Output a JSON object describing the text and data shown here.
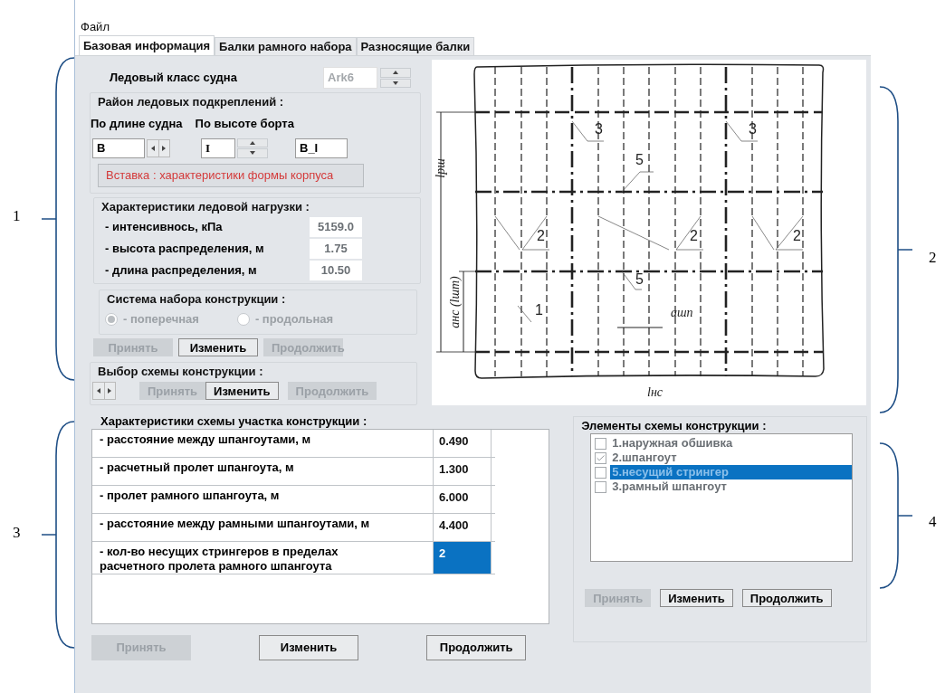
{
  "menu": [
    "Файл"
  ],
  "tabs": [
    {
      "label": "Базовая информация",
      "selected": true
    },
    {
      "label": "Балки рамного набора",
      "selected": false
    },
    {
      "label": "Разносящие балки",
      "selected": false
    }
  ],
  "ice_class": {
    "label": "Ледовый класс судна",
    "value": "Ark6"
  },
  "reinforcement_area": {
    "title": "Район ледовых подкреплений :",
    "length_label": "По длине судна",
    "height_label": "По высоте борта",
    "length_value": "B",
    "height_value": "I",
    "combined_value": "B_I",
    "notice": "Вставка : характеристики формы корпуса"
  },
  "ice_load": {
    "title": "Характеристики ледовой нагрузки :",
    "rows": [
      {
        "label": "- интенсивнось, кПа",
        "value": "5159.0"
      },
      {
        "label": "- высота распределения, м",
        "value": "1.75"
      },
      {
        "label": "- длина распределения, м",
        "value": "10.50"
      }
    ]
  },
  "framing_system": {
    "title": "Система набора конструкции :",
    "options": [
      {
        "label": "- поперечная",
        "selected": true
      },
      {
        "label": "- продольная",
        "selected": false
      }
    ],
    "buttons": [
      {
        "label": "Принять",
        "disabled": true
      },
      {
        "label": "Изменить",
        "disabled": false
      },
      {
        "label": "Продолжить",
        "disabled": true
      }
    ]
  },
  "scheme_choice": {
    "title": "Выбор схемы конструкции :",
    "buttons": [
      {
        "label": "Принять",
        "disabled": true
      },
      {
        "label": "Изменить",
        "disabled": false
      },
      {
        "label": "Продолжить",
        "disabled": true
      }
    ]
  },
  "diagram": {
    "labels": [
      {
        "text": "3",
        "kind": "number"
      },
      {
        "text": "3",
        "kind": "number"
      },
      {
        "text": "5",
        "kind": "number"
      },
      {
        "text": "2",
        "kind": "number"
      },
      {
        "text": "2",
        "kind": "number"
      },
      {
        "text": "2",
        "kind": "number"
      },
      {
        "text": "5",
        "kind": "number"
      },
      {
        "text": "1",
        "kind": "number"
      },
      {
        "text": "lрш",
        "kind": "vertical"
      },
      {
        "text": "aнс (lшт)",
        "kind": "vertical"
      },
      {
        "text": "aшп",
        "kind": "symbol"
      },
      {
        "text": "lнс",
        "kind": "symbol"
      }
    ]
  },
  "scheme_characteristics": {
    "title": "Характеристики схемы участка конструкции :",
    "rows": [
      {
        "label": "- расстояние между шпангоутами, м",
        "value": "0.490",
        "selected": false
      },
      {
        "label": "- расчетный пролет шпангоута, м",
        "value": "1.300",
        "selected": false
      },
      {
        "label": "- пролет рамного шпангоута, м",
        "value": "6.000",
        "selected": false
      },
      {
        "label": "- расстояние между рамными шпангоутами, м",
        "value": "4.400",
        "selected": false
      },
      {
        "label": "- кол-во несущих стрингеров в пределах\nрасчетного пролета рамного шпангоута",
        "value": "2",
        "selected": true
      }
    ],
    "buttons": [
      {
        "label": "Принять",
        "disabled": true
      },
      {
        "label": "Изменить",
        "disabled": false
      },
      {
        "label": "Продолжить",
        "disabled": false
      }
    ]
  },
  "scheme_elements": {
    "title": "Элементы схемы конструкции :",
    "items": [
      {
        "label": "1.наружная обшивка",
        "checked": false,
        "selected": false
      },
      {
        "label": "2.шпангоут",
        "checked": true,
        "selected": false
      },
      {
        "label": "5.несущий стрингер",
        "checked": false,
        "selected": true
      },
      {
        "label": "3.рамный шпангоут",
        "checked": false,
        "selected": false
      }
    ],
    "buttons": [
      {
        "label": "Принять",
        "disabled": true
      },
      {
        "label": "Изменить",
        "disabled": false
      },
      {
        "label": "Продолжить",
        "disabled": false
      }
    ]
  },
  "callouts": [
    "1",
    "2",
    "3",
    "4"
  ]
}
